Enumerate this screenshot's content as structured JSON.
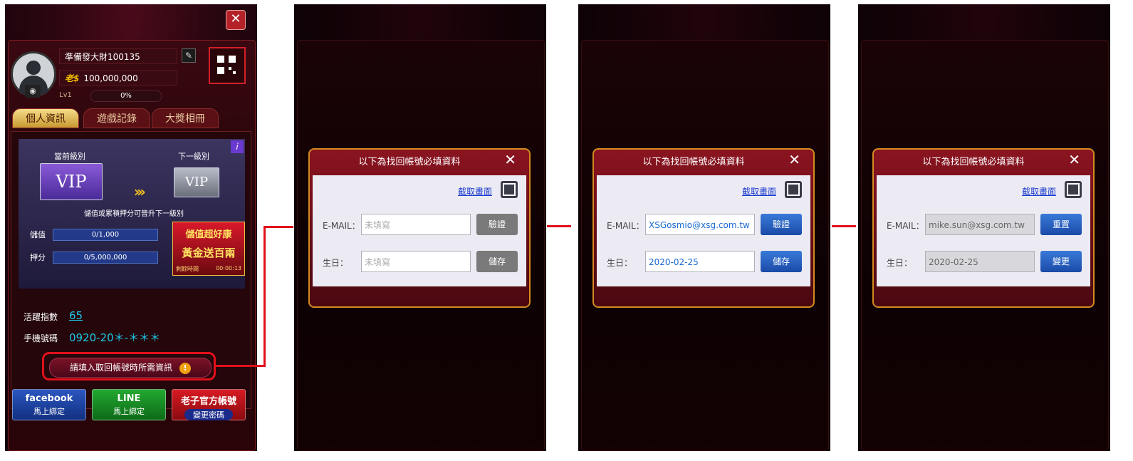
{
  "panels": [
    {
      "user_name": "準備發大財100135",
      "coin_icon": "老$",
      "coins": "100,000,000",
      "level": "Lv1",
      "xp": "0%",
      "tabs": [
        "個人資訊",
        "遊戲記錄",
        "大獎相冊"
      ],
      "current_level_label": "當前級別",
      "next_level_label": "下一級別",
      "vip_text": "VIP",
      "upgrade_hint": "儲值或累積押分可晉升下一級別",
      "deposit_label": "儲值",
      "deposit_progress": "0/1,000",
      "bet_label": "押分",
      "bet_progress": "0/5,000,000",
      "promo_title": "儲值超好康",
      "promo_sub": "黃金送百兩",
      "promo_time_label": "剩餘時間",
      "promo_time": "00:00:13",
      "activity_label": "活躍指數",
      "activity_value": "65",
      "phone_label": "手機號碼",
      "phone_value": "0920-20＊-＊＊＊",
      "action_label": "請填入取回帳號時所需資訊",
      "facebook_title": "facebook",
      "facebook_sub": "馬上綁定",
      "line_title": "LINE",
      "line_sub": "馬上綁定",
      "official_title": "老子官方帳號",
      "official_sub": "變更密碼"
    }
  ],
  "dialogs": [
    {
      "title": "以下為找回帳號必填資料",
      "capture_link": "截取畫面",
      "email_label": "E-MAIL：",
      "email_value": "未填寫",
      "verify_button": "驗證",
      "birthday_label": "生日：",
      "birthday_value": "未填寫",
      "save_button": "儲存"
    },
    {
      "title": "以下為找回帳號必填資料",
      "capture_link": "截取畫面",
      "email_label": "E-MAIL：",
      "email_value": "XSGosmio@xsg.com.tw",
      "verify_button": "驗證",
      "birthday_label": "生日：",
      "birthday_value": "2020-02-25",
      "save_button": "儲存"
    },
    {
      "title": "以下為找回帳號必填資料",
      "capture_link": "截取畫面",
      "email_label": "E-MAIL：",
      "email_value": "mike.sun@xsg.com.tw",
      "verify_button": "重置",
      "birthday_label": "生日：",
      "birthday_value": "2020-02-25",
      "save_button": "變更"
    }
  ],
  "colors": {
    "highlight": "#e0101a",
    "link": "#1a3ad0",
    "value_cyan": "#1fc8e8"
  }
}
